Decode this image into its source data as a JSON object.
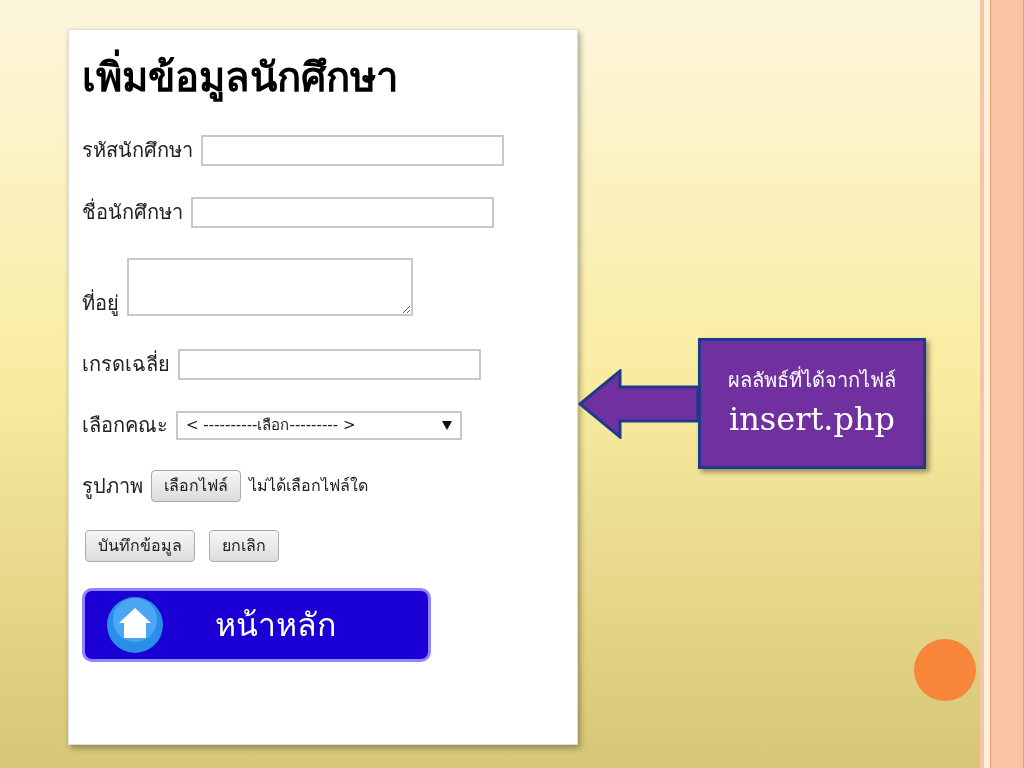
{
  "form": {
    "title": "เพิ่มข้อมูลนักศึกษา",
    "fields": [
      {
        "kind": "text",
        "label": "รหัสนักศึกษา"
      },
      {
        "kind": "text",
        "label": "ชื่อนักศึกษา"
      },
      {
        "kind": "textarea",
        "label": "ที่อยู่"
      },
      {
        "kind": "text",
        "label": "เกรดเฉลี่ย"
      },
      {
        "kind": "select",
        "label": "เลือกคณะ",
        "value": "< ----------เลือก--------- >"
      },
      {
        "kind": "file",
        "label": "รูปภาพ",
        "button": "เลือกไฟล์",
        "status": "ไม่ได้เลือกไฟล์ใด"
      }
    ],
    "buttons": [
      "บันทึกข้อมูล",
      "ยกเลิก"
    ],
    "home_button": "หน้าหลัก"
  },
  "callout": {
    "line_1": "ผลลัพธ์ที่ได้จากไฟล์",
    "line_2": "insert.php"
  }
}
